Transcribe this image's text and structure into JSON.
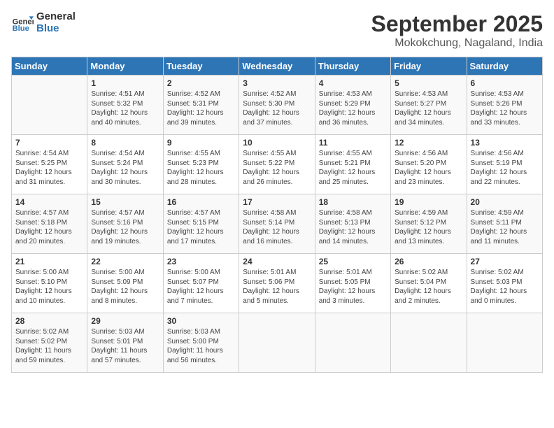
{
  "header": {
    "logo_line1": "General",
    "logo_line2": "Blue",
    "month": "September 2025",
    "location": "Mokokchung, Nagaland, India"
  },
  "weekdays": [
    "Sunday",
    "Monday",
    "Tuesday",
    "Wednesday",
    "Thursday",
    "Friday",
    "Saturday"
  ],
  "weeks": [
    [
      {
        "day": "",
        "content": ""
      },
      {
        "day": "1",
        "content": "Sunrise: 4:51 AM\nSunset: 5:32 PM\nDaylight: 12 hours\nand 40 minutes."
      },
      {
        "day": "2",
        "content": "Sunrise: 4:52 AM\nSunset: 5:31 PM\nDaylight: 12 hours\nand 39 minutes."
      },
      {
        "day": "3",
        "content": "Sunrise: 4:52 AM\nSunset: 5:30 PM\nDaylight: 12 hours\nand 37 minutes."
      },
      {
        "day": "4",
        "content": "Sunrise: 4:53 AM\nSunset: 5:29 PM\nDaylight: 12 hours\nand 36 minutes."
      },
      {
        "day": "5",
        "content": "Sunrise: 4:53 AM\nSunset: 5:27 PM\nDaylight: 12 hours\nand 34 minutes."
      },
      {
        "day": "6",
        "content": "Sunrise: 4:53 AM\nSunset: 5:26 PM\nDaylight: 12 hours\nand 33 minutes."
      }
    ],
    [
      {
        "day": "7",
        "content": "Sunrise: 4:54 AM\nSunset: 5:25 PM\nDaylight: 12 hours\nand 31 minutes."
      },
      {
        "day": "8",
        "content": "Sunrise: 4:54 AM\nSunset: 5:24 PM\nDaylight: 12 hours\nand 30 minutes."
      },
      {
        "day": "9",
        "content": "Sunrise: 4:55 AM\nSunset: 5:23 PM\nDaylight: 12 hours\nand 28 minutes."
      },
      {
        "day": "10",
        "content": "Sunrise: 4:55 AM\nSunset: 5:22 PM\nDaylight: 12 hours\nand 26 minutes."
      },
      {
        "day": "11",
        "content": "Sunrise: 4:55 AM\nSunset: 5:21 PM\nDaylight: 12 hours\nand 25 minutes."
      },
      {
        "day": "12",
        "content": "Sunrise: 4:56 AM\nSunset: 5:20 PM\nDaylight: 12 hours\nand 23 minutes."
      },
      {
        "day": "13",
        "content": "Sunrise: 4:56 AM\nSunset: 5:19 PM\nDaylight: 12 hours\nand 22 minutes."
      }
    ],
    [
      {
        "day": "14",
        "content": "Sunrise: 4:57 AM\nSunset: 5:18 PM\nDaylight: 12 hours\nand 20 minutes."
      },
      {
        "day": "15",
        "content": "Sunrise: 4:57 AM\nSunset: 5:16 PM\nDaylight: 12 hours\nand 19 minutes."
      },
      {
        "day": "16",
        "content": "Sunrise: 4:57 AM\nSunset: 5:15 PM\nDaylight: 12 hours\nand 17 minutes."
      },
      {
        "day": "17",
        "content": "Sunrise: 4:58 AM\nSunset: 5:14 PM\nDaylight: 12 hours\nand 16 minutes."
      },
      {
        "day": "18",
        "content": "Sunrise: 4:58 AM\nSunset: 5:13 PM\nDaylight: 12 hours\nand 14 minutes."
      },
      {
        "day": "19",
        "content": "Sunrise: 4:59 AM\nSunset: 5:12 PM\nDaylight: 12 hours\nand 13 minutes."
      },
      {
        "day": "20",
        "content": "Sunrise: 4:59 AM\nSunset: 5:11 PM\nDaylight: 12 hours\nand 11 minutes."
      }
    ],
    [
      {
        "day": "21",
        "content": "Sunrise: 5:00 AM\nSunset: 5:10 PM\nDaylight: 12 hours\nand 10 minutes."
      },
      {
        "day": "22",
        "content": "Sunrise: 5:00 AM\nSunset: 5:09 PM\nDaylight: 12 hours\nand 8 minutes."
      },
      {
        "day": "23",
        "content": "Sunrise: 5:00 AM\nSunset: 5:07 PM\nDaylight: 12 hours\nand 7 minutes."
      },
      {
        "day": "24",
        "content": "Sunrise: 5:01 AM\nSunset: 5:06 PM\nDaylight: 12 hours\nand 5 minutes."
      },
      {
        "day": "25",
        "content": "Sunrise: 5:01 AM\nSunset: 5:05 PM\nDaylight: 12 hours\nand 3 minutes."
      },
      {
        "day": "26",
        "content": "Sunrise: 5:02 AM\nSunset: 5:04 PM\nDaylight: 12 hours\nand 2 minutes."
      },
      {
        "day": "27",
        "content": "Sunrise: 5:02 AM\nSunset: 5:03 PM\nDaylight: 12 hours\nand 0 minutes."
      }
    ],
    [
      {
        "day": "28",
        "content": "Sunrise: 5:02 AM\nSunset: 5:02 PM\nDaylight: 11 hours\nand 59 minutes."
      },
      {
        "day": "29",
        "content": "Sunrise: 5:03 AM\nSunset: 5:01 PM\nDaylight: 11 hours\nand 57 minutes."
      },
      {
        "day": "30",
        "content": "Sunrise: 5:03 AM\nSunset: 5:00 PM\nDaylight: 11 hours\nand 56 minutes."
      },
      {
        "day": "",
        "content": ""
      },
      {
        "day": "",
        "content": ""
      },
      {
        "day": "",
        "content": ""
      },
      {
        "day": "",
        "content": ""
      }
    ]
  ]
}
